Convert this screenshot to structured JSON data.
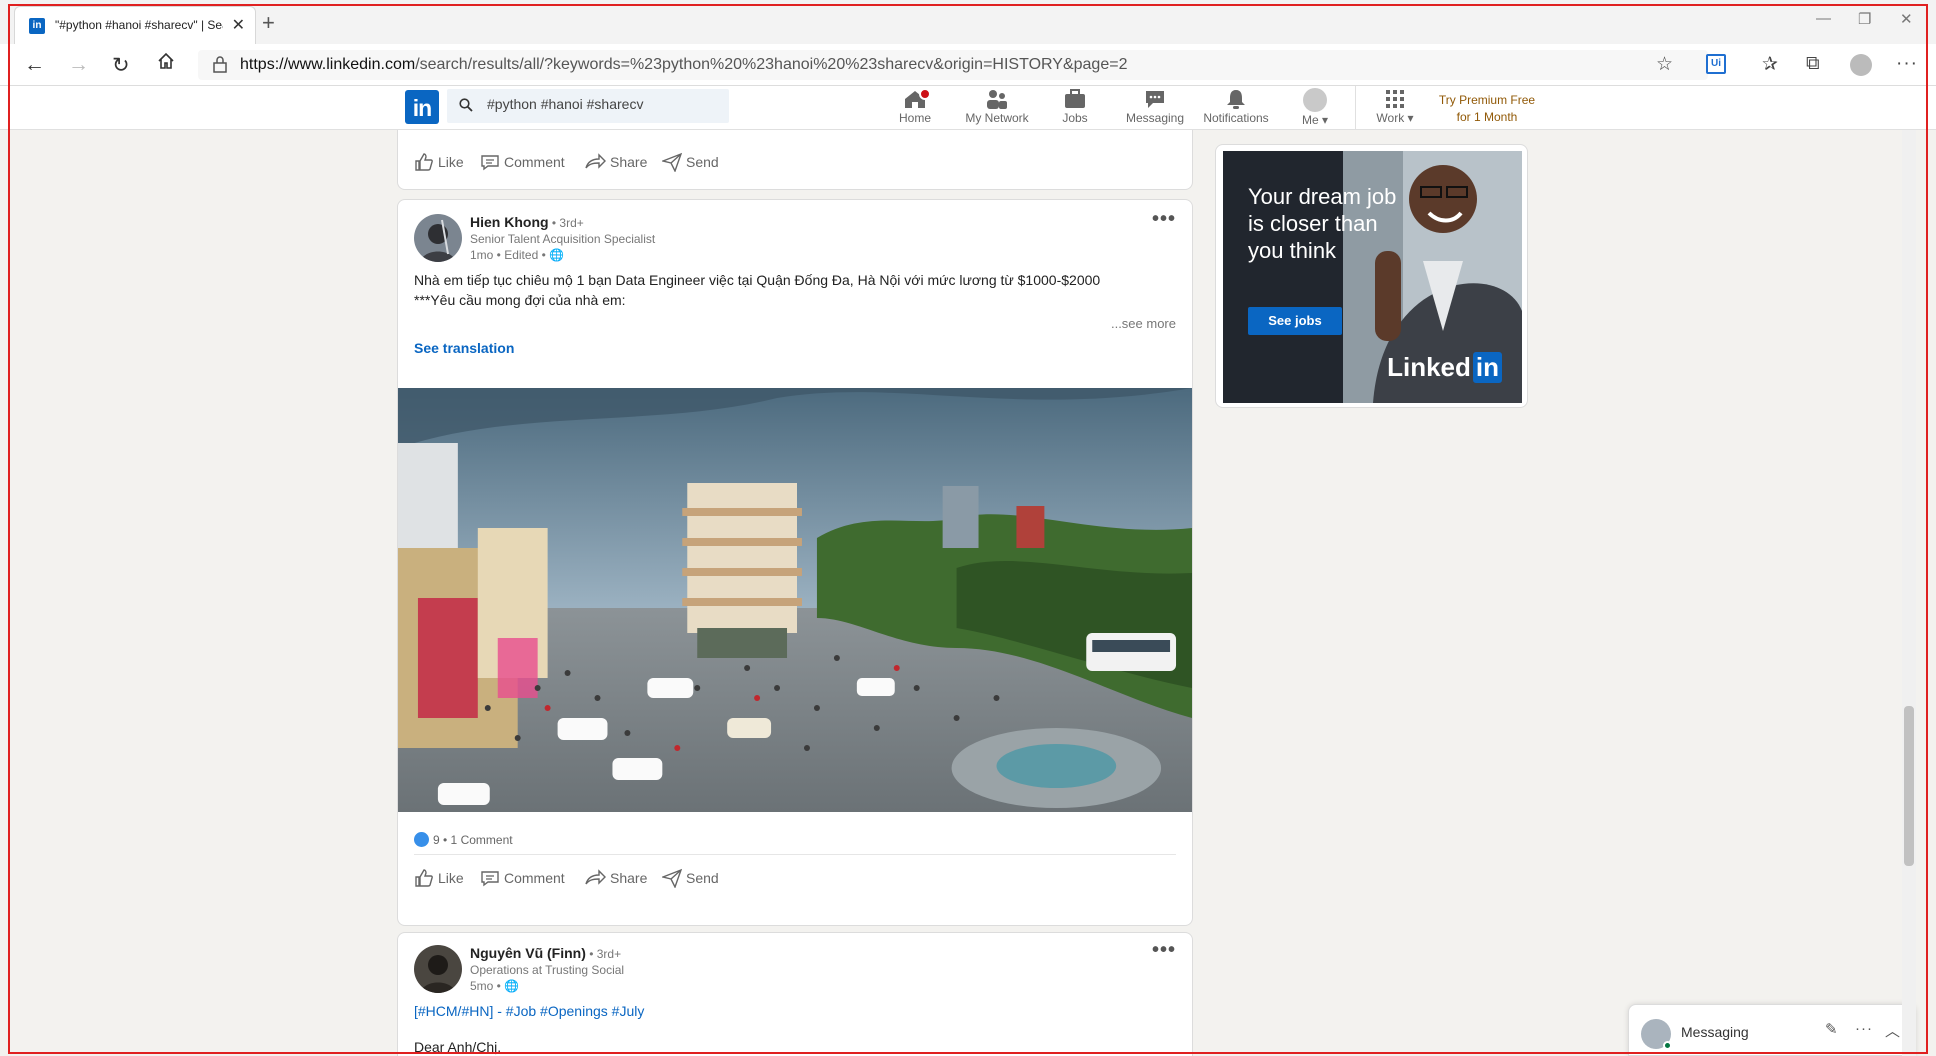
{
  "browser": {
    "tab_title": "\"#python #hanoi #sharecv\" | Sea",
    "tab_favicon": "in",
    "url_domain": "https://www.linkedin.com",
    "url_path": "/search/results/all/?keywords=%23python%20%23hanoi%20%23sharecv&origin=HISTORY&page=2",
    "ui_badge": "Ui"
  },
  "header": {
    "logo": "in",
    "search_value": "#python #hanoi #sharecv",
    "nav": {
      "home": "Home",
      "network": "My Network",
      "jobs": "Jobs",
      "messaging": "Messaging",
      "notifications": "Notifications",
      "me": "Me",
      "work": "Work"
    },
    "premium_line1": "Try Premium Free",
    "premium_line2": "for 1 Month"
  },
  "actions": {
    "like": "Like",
    "comment": "Comment",
    "share": "Share",
    "send": "Send"
  },
  "post1": {
    "author": "Hien Khong",
    "degree": " • 3rd+",
    "headline": "Senior Talent Acquisition Specialist",
    "time": "1mo • Edited •",
    "text_line1": "Nhà em tiếp tục chiêu mộ 1 bạn Data Engineer việc tại Quận Đống Đa, Hà Nội với mức lương từ $1000-$2000",
    "text_line2": "***Yêu cầu mong đợi của nhà em:",
    "see_more": "...see more",
    "see_translation": "See translation",
    "reactions": "9",
    "comments": " • 1 Comment"
  },
  "post2": {
    "author": "Nguyên Vũ (Finn)",
    "degree": " • 3rd+",
    "headline": "Operations at Trusting Social",
    "time": "5mo •",
    "tag_prefix": "[#HCM/#HN] - ",
    "tags": "#Job #Openings #July",
    "text_partial": "Dear Anh/Chị,"
  },
  "ad": {
    "headline": "Your dream job is closer than you think",
    "button": "See jobs",
    "brand": "Linked",
    "brand_in": "in"
  },
  "messaging": {
    "label": "Messaging"
  },
  "colors": {
    "linkedin_blue": "#0a66c2",
    "premium_gold": "#915907",
    "notification_red": "#cc1016"
  }
}
